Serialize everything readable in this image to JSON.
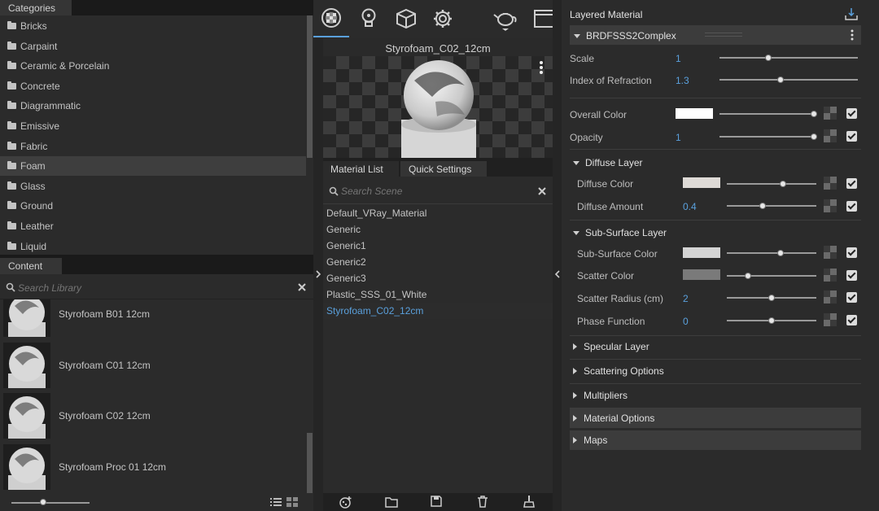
{
  "categories": {
    "header": "Categories",
    "items": [
      {
        "label": "Bricks"
      },
      {
        "label": "Carpaint"
      },
      {
        "label": "Ceramic & Porcelain"
      },
      {
        "label": "Concrete"
      },
      {
        "label": "Diagrammatic"
      },
      {
        "label": "Emissive"
      },
      {
        "label": "Fabric"
      },
      {
        "label": "Foam",
        "selected": true
      },
      {
        "label": "Glass"
      },
      {
        "label": "Ground"
      },
      {
        "label": "Leather"
      },
      {
        "label": "Liquid"
      }
    ]
  },
  "content": {
    "header": "Content",
    "search_placeholder": "Search Library",
    "items": [
      {
        "label": "Styrofoam B01 12cm"
      },
      {
        "label": "Styrofoam C01 12cm"
      },
      {
        "label": "Styrofoam C02 12cm"
      },
      {
        "label": "Styrofoam Proc 01 12cm"
      }
    ],
    "thumb_size": 0.15
  },
  "toolbar": {
    "icons": [
      "material-sphere-icon",
      "light-bulb-icon",
      "cube-icon",
      "gear-icon",
      "teapot-render-icon",
      "frame-buffer-icon"
    ]
  },
  "preview": {
    "title": "Styrofoam_C02_12cm"
  },
  "material_tabs": {
    "list": "Material List",
    "quick": "Quick Settings"
  },
  "scene": {
    "search_placeholder": "Search Scene",
    "materials": [
      {
        "label": "Default_VRay_Material"
      },
      {
        "label": "Generic"
      },
      {
        "label": "Generic1"
      },
      {
        "label": "Generic2"
      },
      {
        "label": "Generic3"
      },
      {
        "label": "Plastic_SSS_01_White"
      },
      {
        "label": "Styrofoam_C02_12cm",
        "selected": true
      }
    ]
  },
  "editor": {
    "title": "Layered Material",
    "brdf": "BRDFSSS2Complex",
    "scale": {
      "label": "Scale",
      "value": "1",
      "level": 0.35
    },
    "ior": {
      "label": "Index of Refraction",
      "value": "1.3",
      "level": 0.44
    },
    "overall_color": {
      "label": "Overall Color",
      "color": "#ffffff",
      "level": 1.0
    },
    "opacity": {
      "label": "Opacity",
      "value": "1",
      "level": 1.0
    },
    "diffuse_layer": {
      "title": "Diffuse Layer",
      "color": {
        "label": "Diffuse Color",
        "color": "#dedad6",
        "level": 0.63
      },
      "amount": {
        "label": "Diffuse Amount",
        "value": "0.4",
        "level": 0.4
      }
    },
    "sss_layer": {
      "title": "Sub-Surface Layer",
      "color": {
        "label": "Sub-Surface Color",
        "color": "#d4d4d4",
        "level": 0.6
      },
      "scatter": {
        "label": "Scatter Color",
        "color": "#7a7a7a",
        "level": 0.24
      },
      "radius": {
        "label": "Scatter Radius (cm)",
        "value": "2",
        "level": 0.5
      },
      "phase": {
        "label": "Phase Function",
        "value": "0",
        "level": 0.5
      }
    },
    "collapsed": [
      {
        "label": "Specular Layer"
      },
      {
        "label": "Scattering Options"
      },
      {
        "label": "Multipliers"
      },
      {
        "label": "Material Options"
      },
      {
        "label": "Maps"
      }
    ]
  }
}
